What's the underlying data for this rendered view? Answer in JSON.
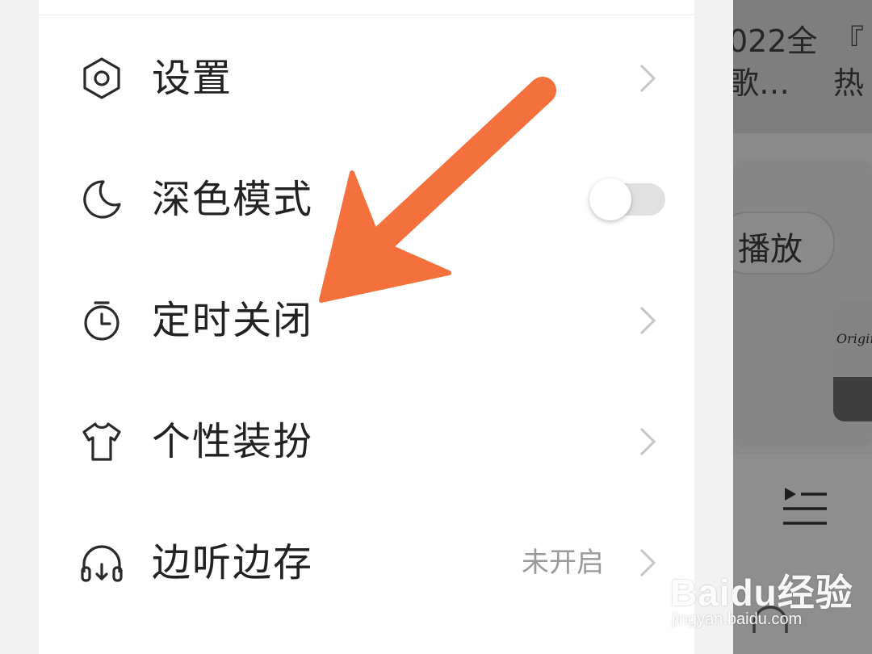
{
  "menu": {
    "items": [
      {
        "label": "设置",
        "icon": "hexagon-settings-icon",
        "chevron": true
      },
      {
        "label": "深色模式",
        "icon": "moon-icon",
        "toggle": false
      },
      {
        "label": "定时关闭",
        "icon": "timer-icon",
        "chevron": true
      },
      {
        "label": "个性装扮",
        "icon": "tshirt-icon",
        "chevron": true
      },
      {
        "label": "边听边存",
        "icon": "headphones-download-icon",
        "chevron": true,
        "status": "未开启"
      }
    ]
  },
  "background_app": {
    "card_texts": [
      "022全",
      "歌…",
      "『",
      "热"
    ],
    "play_button": "播放",
    "thumb_text": "Origina",
    "overlay_color": "#8a8a8a"
  },
  "annotation": {
    "arrow_color": "#f4703d",
    "arrow_points_to": "定时关闭"
  },
  "watermark": {
    "logo": "Baidu经验",
    "url": "jingyan.baidu.com"
  },
  "colors": {
    "drawer_bg": "#ffffff",
    "text": "#222222",
    "secondary_text": "#9a9a9a",
    "chevron": "#c6c6c6",
    "toggle_track": "#e1e1e1"
  }
}
